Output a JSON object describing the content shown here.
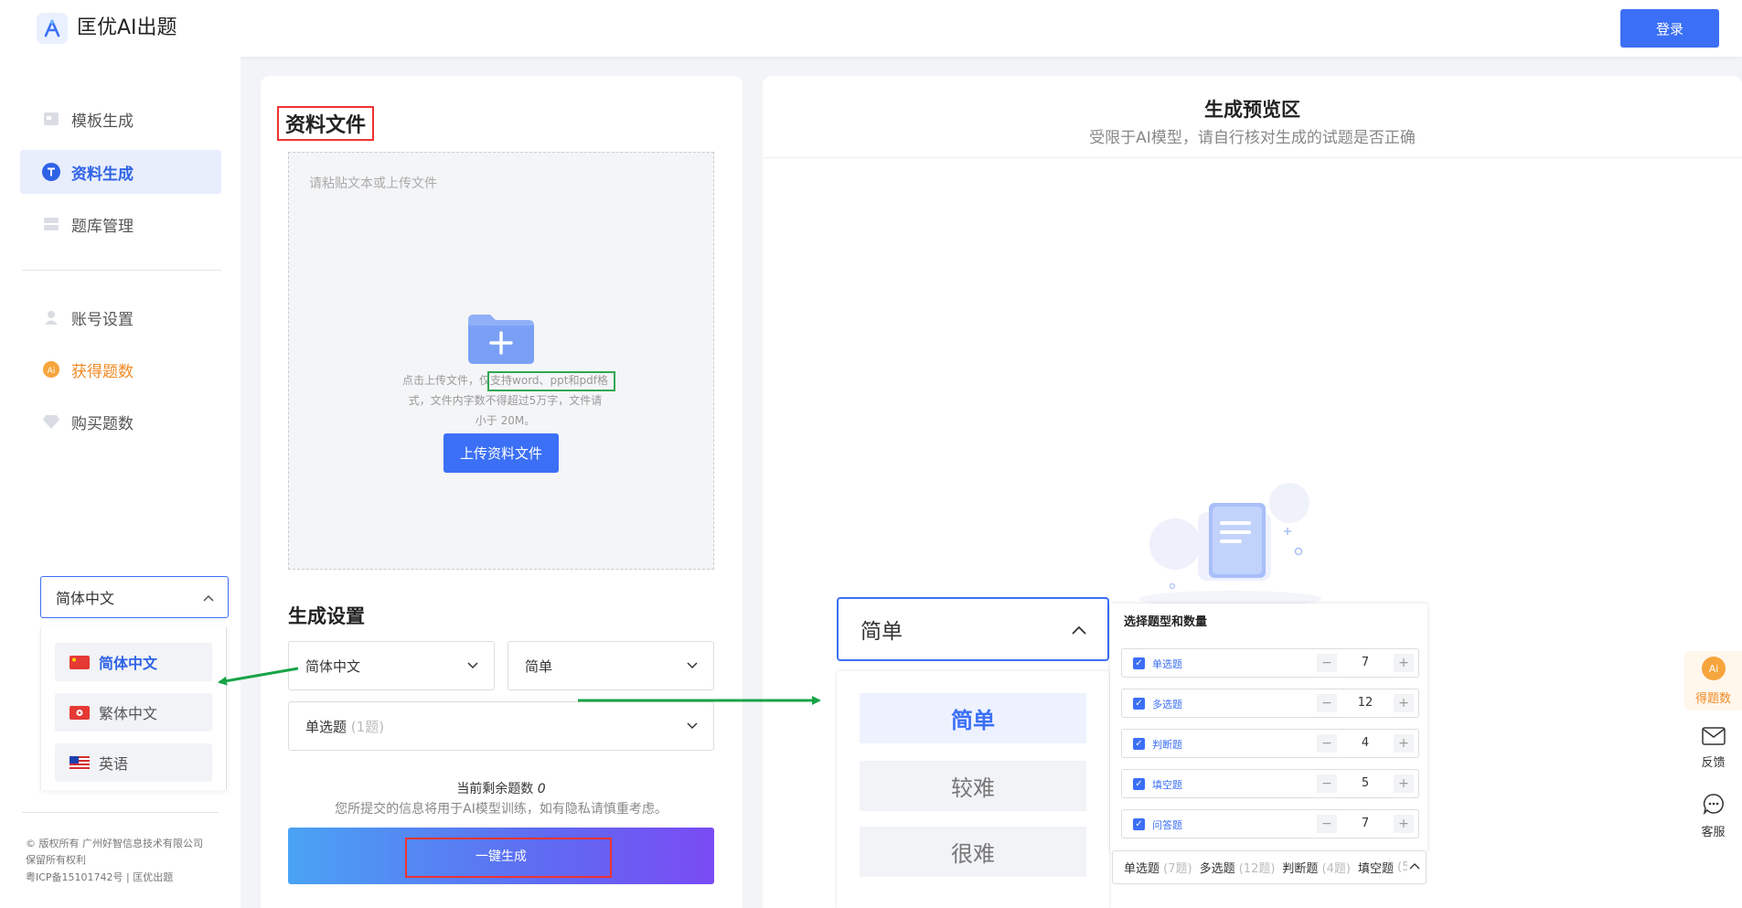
{
  "header": {
    "app_title": "匡优AI出题",
    "login_label": "登录"
  },
  "sidebar": {
    "items": [
      {
        "label": "模板生成",
        "icon": "template-icon"
      },
      {
        "label": "资料生成",
        "icon": "text-t-icon",
        "active": true
      },
      {
        "label": "题库管理",
        "icon": "question-bank-icon"
      },
      {
        "label": "账号设置",
        "icon": "user-icon"
      },
      {
        "label": "获得题数",
        "icon": "ai-coin-icon"
      },
      {
        "label": "购买题数",
        "icon": "diamond-icon"
      }
    ],
    "language": {
      "selected": "简体中文",
      "options": [
        "简体中文",
        "繁体中文",
        "英语"
      ]
    },
    "footer": [
      "© 版权所有 广州好智信息技术有限公司",
      "保留所有权利",
      "粤ICP备15101742号 | 匡优出题"
    ]
  },
  "source": {
    "title": "资料文件",
    "paste_placeholder": "请粘贴文本或上传文件",
    "upload_hint_lines": [
      "点击上传文件，仅支持word、ppt和pdf格",
      "式，文件内字数不得超过5万字，文件请",
      "小于 20M。"
    ],
    "upload_button": "上传资料文件"
  },
  "settings": {
    "title": "生成设置",
    "language_select": "简体中文",
    "difficulty_select": "简单",
    "question_type_select": "单选题",
    "question_type_count": "(1题)",
    "remaining_label": "当前剩余题数",
    "remaining_value": "0",
    "privacy_note": "您所提交的信息将用于AI模型训练，如有隐私请慎重考虑。",
    "generate_button": "一键生成"
  },
  "preview": {
    "title": "生成预览区",
    "subtitle": "受限于AI模型，请自行核对生成的试题是否正确"
  },
  "difficulty_dropdown": {
    "selected": "简单",
    "options": [
      "简单",
      "较难",
      "很难"
    ]
  },
  "question_types": {
    "title": "选择题型和数量",
    "rows": [
      {
        "name": "单选题",
        "count": "7"
      },
      {
        "name": "多选题",
        "count": "12"
      },
      {
        "name": "判断题",
        "count": "4"
      },
      {
        "name": "填空题",
        "count": "5"
      },
      {
        "name": "问答题",
        "count": "7"
      }
    ],
    "summary": [
      {
        "name": "单选题",
        "count": "(7题)"
      },
      {
        "name": "多选题",
        "count": "(12题)"
      },
      {
        "name": "判断题",
        "count": "(4题)"
      },
      {
        "name": "填空题",
        "count": "(5"
      }
    ]
  },
  "floating": {
    "ai_badge": "Ai",
    "ai": "得题数",
    "feedback": "反馈",
    "service": "客服"
  },
  "colors": {
    "primary": "#3b6ff5",
    "accent_orange": "#f08a24",
    "annotation_red": "#e33333",
    "annotation_green": "#2fa84f"
  }
}
